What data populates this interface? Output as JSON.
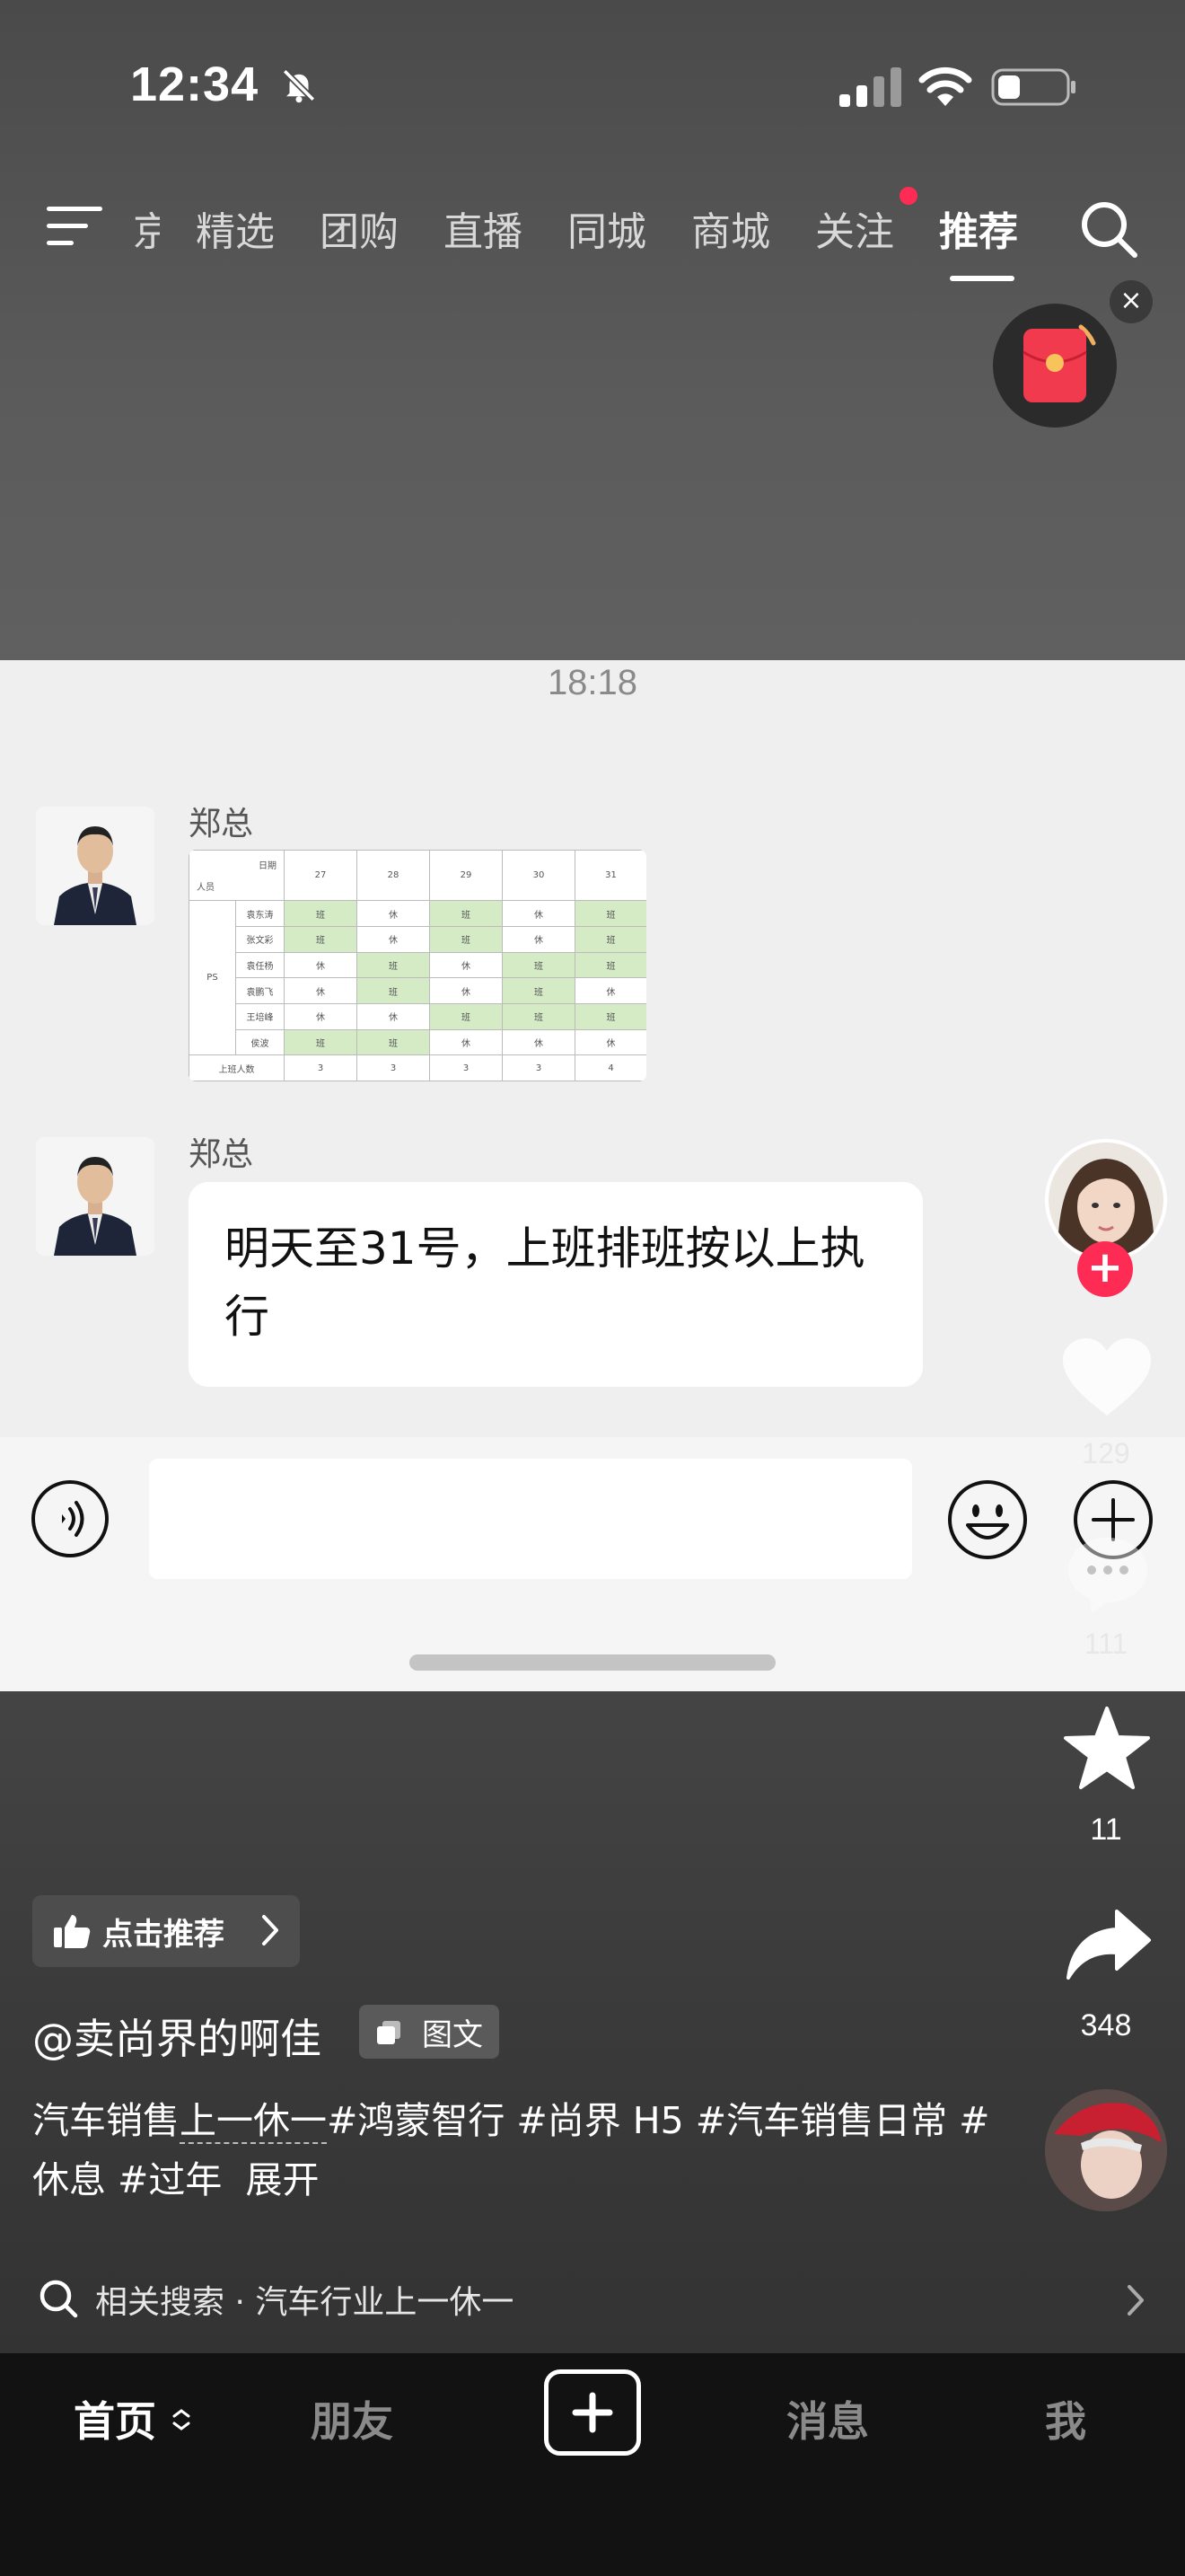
{
  "status_bar": {
    "time": "12:34"
  },
  "top_nav": {
    "tabs": [
      {
        "label": "京",
        "active": false
      },
      {
        "label": "精选",
        "active": false
      },
      {
        "label": "团购",
        "active": false
      },
      {
        "label": "直播",
        "active": false
      },
      {
        "label": "同城",
        "active": false
      },
      {
        "label": "商城",
        "active": false
      },
      {
        "label": "关注",
        "active": false,
        "has_dot": true
      },
      {
        "label": "推荐",
        "active": true
      }
    ],
    "close_label": "×"
  },
  "chat": {
    "timestamp": "18:18",
    "messages": [
      {
        "sender": "郑总",
        "type": "image"
      },
      {
        "sender": "郑总",
        "type": "text",
        "text": "明天至31号，上班排班按以上执行"
      }
    ],
    "schedule": {
      "corner_top": "日期",
      "corner_bottom": "人员",
      "dates": [
        "27",
        "28",
        "29",
        "30",
        "31"
      ],
      "group": "PS",
      "rows": [
        {
          "name": "袁东涛",
          "cells": [
            "班",
            "休",
            "班",
            "休",
            "班"
          ]
        },
        {
          "name": "张文彩",
          "cells": [
            "班",
            "休",
            "班",
            "休",
            "班"
          ]
        },
        {
          "name": "袁任杨",
          "cells": [
            "休",
            "班",
            "休",
            "班",
            "班"
          ]
        },
        {
          "name": "袁鹏飞",
          "cells": [
            "休",
            "班",
            "休",
            "班",
            "休"
          ]
        },
        {
          "name": "王培峰",
          "cells": [
            "休",
            "休",
            "班",
            "班",
            "班"
          ]
        },
        {
          "name": "侯波",
          "cells": [
            "班",
            "班",
            "休",
            "休",
            "休"
          ]
        }
      ],
      "total_label": "上班人数",
      "totals": [
        "3",
        "3",
        "3",
        "3",
        "4"
      ]
    }
  },
  "actions": {
    "follow_label": "+",
    "like_count": "129",
    "comment_count": "111",
    "favorite_count": "11",
    "share_count": "348"
  },
  "caption": {
    "recommend_label": "点击推荐",
    "author": "@卖尚界的啊佳",
    "type_label": "图文",
    "desc_part1": "汽车销售",
    "desc_underlined": "上一休一",
    "desc_part2": "#鸿蒙智行 #尚界 H5 #汽车销售日常 #休息 #过年",
    "expand_label": "展开",
    "related_search": "相关搜索 · 汽车行业上一休一"
  },
  "tabbar": {
    "home": "首页",
    "friends": "朋友",
    "messages": "消息",
    "me": "我"
  },
  "colors": {
    "accent": "#fe2c55",
    "schedule_green": "#d4ebc6"
  }
}
